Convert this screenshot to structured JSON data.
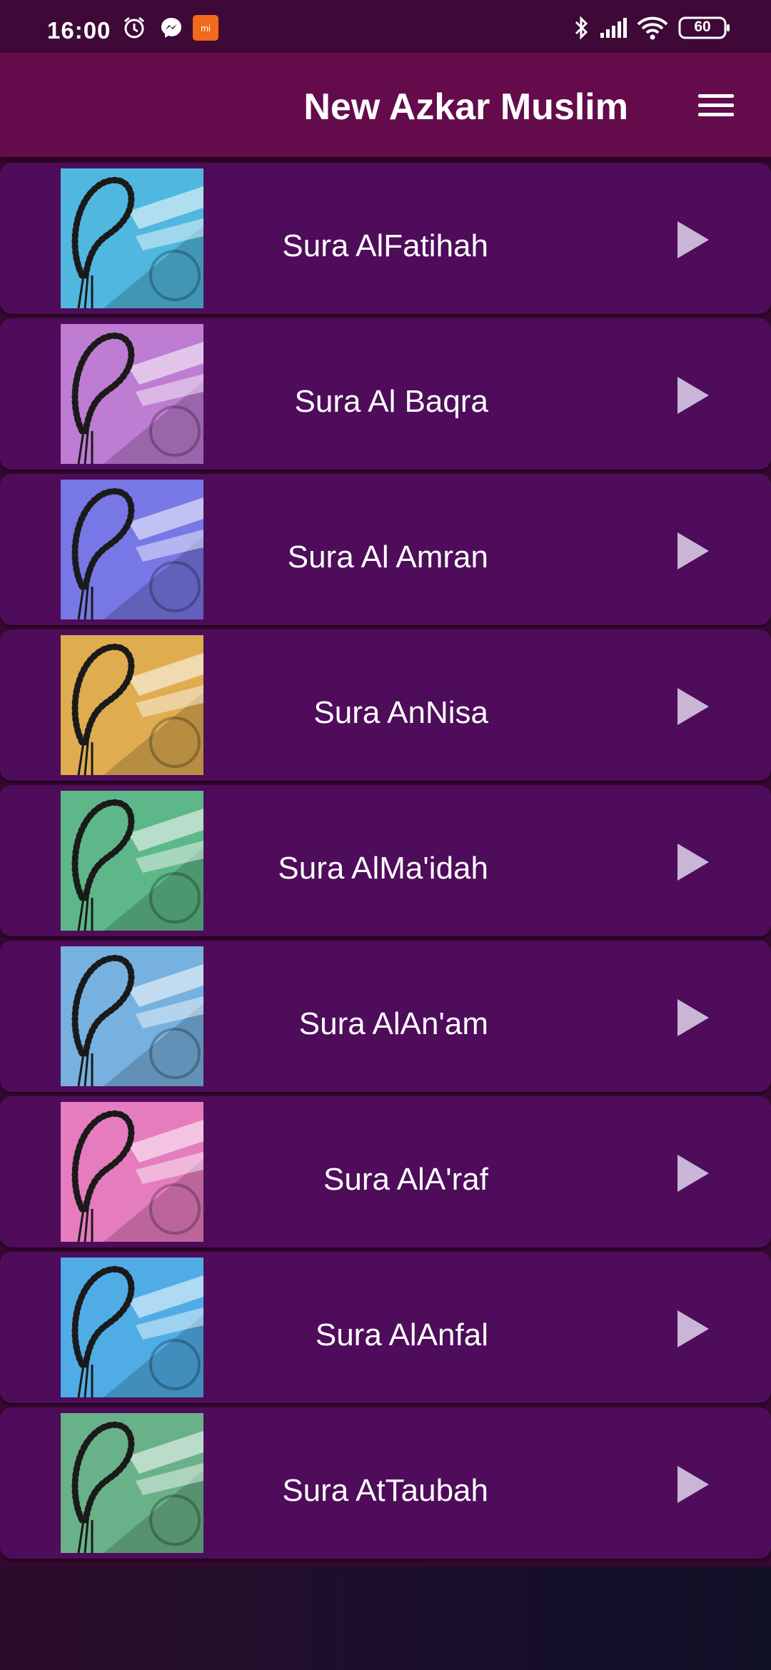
{
  "status_bar": {
    "time": "16:00",
    "battery": "60",
    "left_icons": [
      "alarm-icon",
      "messenger-icon",
      "mi-icon"
    ],
    "right_icons": [
      "bluetooth-icon",
      "signal-icon",
      "wifi-icon",
      "battery-icon"
    ]
  },
  "app_bar": {
    "title": "New Azkar Muslim",
    "menu_icon": "hamburger-menu-icon"
  },
  "colors": {
    "status_bar": "#3e0936",
    "app_bar": "#640b4c",
    "row": "#4e0c5a",
    "background": "#34082f"
  },
  "list": {
    "items": [
      {
        "title": "Sura AlFatihah",
        "tint": "#2aa8d8"
      },
      {
        "title": "Sura Al Baqra",
        "tint": "#b060c8"
      },
      {
        "title": "Sura Al Amran",
        "tint": "#5a5ae0"
      },
      {
        "title": "Sura AnNisa",
        "tint": "#d89a2a"
      },
      {
        "title": "Sura AlMa'idah",
        "tint": "#3aa870"
      },
      {
        "title": "Sura AlAn'am",
        "tint": "#5aa0d8"
      },
      {
        "title": "Sura AlA'raf",
        "tint": "#e060b0"
      },
      {
        "title": "Sura AlAnfal",
        "tint": "#2a9ae0"
      },
      {
        "title": "Sura AtTaubah",
        "tint": "#48a070"
      }
    ]
  }
}
